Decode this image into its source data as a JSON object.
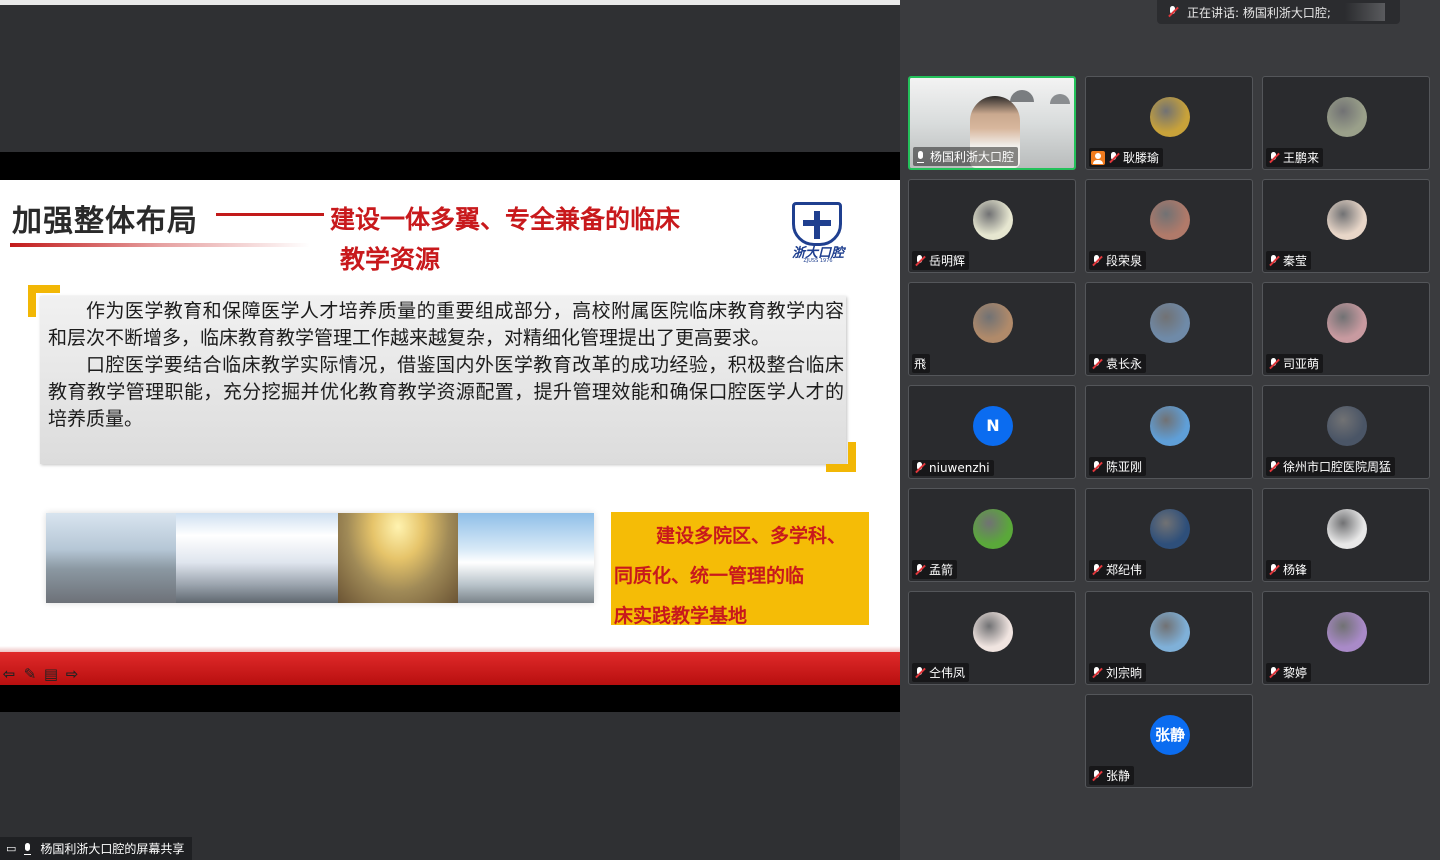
{
  "share": {
    "slide": {
      "title": "加强整体布局",
      "subtitle_line1": "建设一体多翼、专全兼备的临床",
      "subtitle_line2": "教学资源",
      "logo_text": "浙大口腔",
      "logo_sub": "ZJUSS 1976",
      "paragraph1": "作为医学教育和保障医学人才培养质量的重要组成部分，高校附属医院临床教育教学内容和层次不断增多，临床教育教学管理工作越来越复杂，对精细化管理提出了更高要求。",
      "paragraph2": "口腔医学要结合临床教学实际情况，借鉴国内外医学教育改革的成功经验，积极整合临床教育教学管理职能，充分挖掘并优化教育教学资源配置，提升管理效能和确保口腔医学人才的培养质量。",
      "callout_line1": "建设多院区、多学科、",
      "callout_line2": "同质化、统一管理的临",
      "callout_line3": "床实践教学基地",
      "nav": [
        "⇦",
        "✎",
        "▤",
        "⇨"
      ]
    },
    "label": "杨国利浙大口腔的屏幕共享",
    "accent_colors": {
      "title_red": "#c8191c",
      "callout_yellow": "#f5bc06",
      "active_speaker": "#23c15a"
    }
  },
  "speaking": {
    "text": "正在讲话: 杨国利浙大口腔;"
  },
  "participants": [
    {
      "name": "杨国利浙大口腔",
      "mic": "on",
      "video": true,
      "active": true
    },
    {
      "name": "耿滕瑜",
      "mic": "muted",
      "host": true,
      "avatar_color": "#c8a23a"
    },
    {
      "name": "王鹏来",
      "mic": "muted",
      "avatar_color": "#9aa08a"
    },
    {
      "name": "岳明辉",
      "mic": "muted",
      "avatar_color": "#e6e6d0"
    },
    {
      "name": "段荣泉",
      "mic": "muted",
      "avatar_color": "#b07a6a"
    },
    {
      "name": "秦莹",
      "mic": "muted",
      "avatar_color": "#e8d6c8"
    },
    {
      "name": "飛",
      "mic": "none",
      "avatar_color": "#b08a6a"
    },
    {
      "name": "袁长永",
      "mic": "muted",
      "avatar_color": "#6f8aa8"
    },
    {
      "name": "司亚萌",
      "mic": "muted",
      "avatar_color": "#c89aa0"
    },
    {
      "name": "niuwenzhi",
      "mic": "muted",
      "initial": "N"
    },
    {
      "name": "陈亚刚",
      "mic": "muted",
      "avatar_color": "#5f9fd8"
    },
    {
      "name": "徐州市口腔医院周猛",
      "mic": "muted",
      "avatar_color": "#4a5566"
    },
    {
      "name": "孟箭",
      "mic": "muted",
      "avatar_color": "#5aa83a"
    },
    {
      "name": "郑纪伟",
      "mic": "muted",
      "avatar_color": "#2e4f7a"
    },
    {
      "name": "杨锋",
      "mic": "muted",
      "avatar_color": "#e8e8e8"
    },
    {
      "name": "仝伟凤",
      "mic": "muted",
      "avatar_color": "#f0e4e0"
    },
    {
      "name": "刘宗晌",
      "mic": "muted",
      "avatar_color": "#7fb0d8"
    },
    {
      "name": "黎婷",
      "mic": "muted",
      "avatar_color": "#a98ac8"
    },
    {
      "name": "张静",
      "mic": "muted",
      "initial": "张静"
    }
  ]
}
